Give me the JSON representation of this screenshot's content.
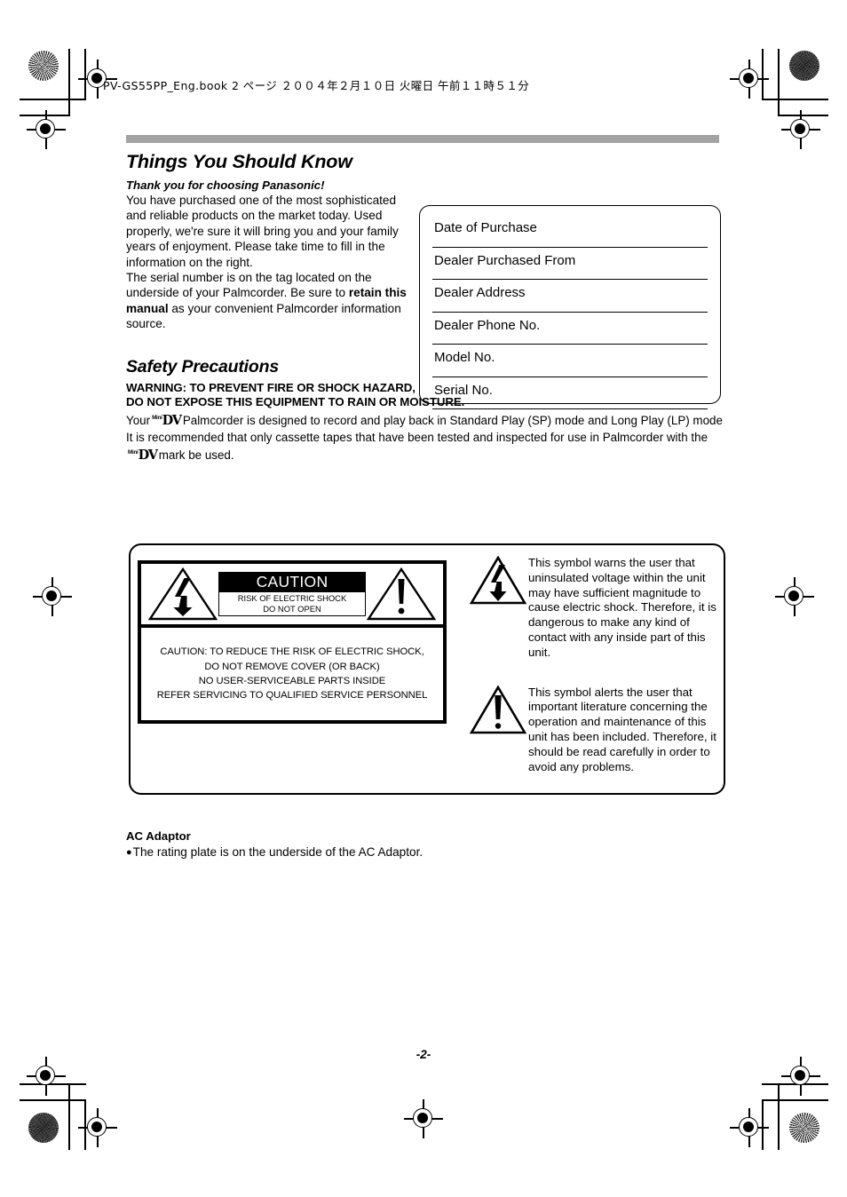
{
  "print_slug": "PV-GS55PP_Eng.book  2 ページ  ２００４年２月１０日  火曜日  午前１１時５１分",
  "page_number": "-2-",
  "things_you_should_know": {
    "title": "Things You Should Know",
    "lead": "Thank you for choosing Panasonic!",
    "paragraph_1": "You have purchased one of the most sophisticated and reliable products on the market today. Used properly, we're sure it will bring you and your family years of enjoyment. Please take time to fill in the information on the right.",
    "paragraph_2_part1": "The serial number is on the tag located on the underside of your Palmcorder. Be sure to ",
    "paragraph_2_bold": "retain this manual",
    "paragraph_2_part2": " as your convenient Palmcorder information source."
  },
  "purchase_record": {
    "fields": [
      "Date of Purchase",
      "Dealer Purchased From",
      "Dealer Address",
      "Dealer Phone No.",
      "Model No.",
      "Serial No."
    ]
  },
  "safety_precautions": {
    "title": "Safety Precautions",
    "warning_line_1": "WARNING: TO PREVENT FIRE OR SHOCK HAZARD,",
    "warning_line_2": "DO NOT EXPOSE THIS EQUIPMENT TO RAIN OR MOISTURE.",
    "para_1_before": "Your",
    "para_1_after": "Palmcorder is designed to record and play back in Standard Play (SP) mode and Long Play (LP) mode",
    "para_2_before": "It is recommended that only cassette tapes that have been tested and inspected for use in Palmcorder with the",
    "para_2_after": "mark be used.",
    "minidv_mini": "Mini",
    "minidv_dv": "DV"
  },
  "caution_panel": {
    "label_main": "CAUTION",
    "label_sub_line1": "RISK OF ELECTRIC SHOCK",
    "label_sub_line2": "DO NOT OPEN",
    "notice_line1": "CAUTION: TO REDUCE THE RISK OF ELECTRIC SHOCK,",
    "notice_line2": "DO NOT REMOVE COVER (OR BACK)",
    "notice_line3": "NO USER-SERVICEABLE PARTS INSIDE",
    "notice_line4": "REFER SERVICING TO QUALIFIED SERVICE PERSONNEL",
    "explanations": [
      {
        "symbol": "lightning-bolt-triangle",
        "text": "This symbol warns the user that uninsulated voltage within the unit may have sufficient magnitude to cause electric shock. Therefore, it is dangerous to make any kind of contact with any inside part of this unit."
      },
      {
        "symbol": "exclamation-triangle",
        "text": "This symbol alerts the user that important literature concerning the operation and maintenance of this unit has been included. Therefore, it should be read carefully in order to avoid any problems."
      }
    ]
  },
  "ac_adaptor": {
    "title": "AC Adaptor",
    "bullet": "The rating plate is on the underside of the AC Adaptor."
  },
  "colors": {
    "rule_gray": "#a3a3a3",
    "ink": "#000000",
    "paper": "#ffffff"
  }
}
